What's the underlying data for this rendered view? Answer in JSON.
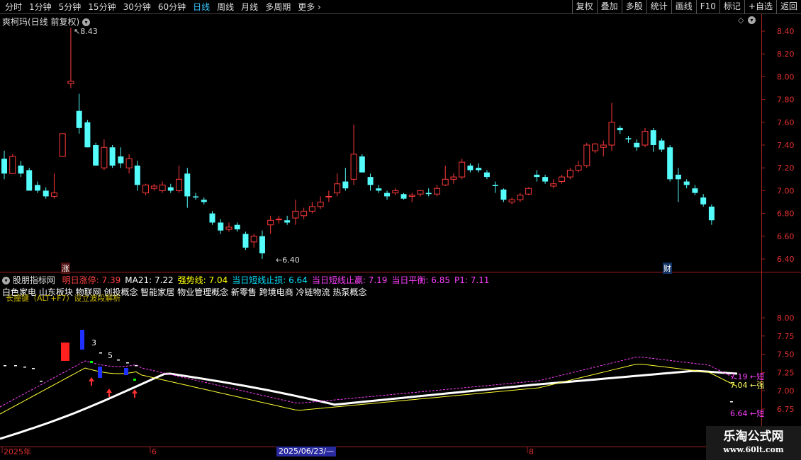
{
  "toolbar": {
    "periods": [
      "分时",
      "1分钟",
      "5分钟",
      "15分钟",
      "30分钟",
      "60分钟",
      "日线",
      "周线",
      "月线",
      "多周期",
      "更多"
    ],
    "active_index": 6,
    "buttons": [
      "复权",
      "叠加",
      "多股",
      "统计",
      "画线",
      "F10",
      "标记",
      "+自选",
      "返回"
    ]
  },
  "main": {
    "title": "爽柯玛(日线 前复权)",
    "high_label": "8.43",
    "low_label": "6.40",
    "marker_zhang": "涨",
    "marker_cai": "财",
    "y_ticks": [
      "8.40",
      "8.20",
      "8.00",
      "7.80",
      "7.60",
      "7.40",
      "7.20",
      "7.00",
      "6.80",
      "6.60",
      "6.40"
    ]
  },
  "indicator": {
    "name": "股朋指标网",
    "legend": [
      {
        "text": "明日涨停: 7.39",
        "color": "#ff4040"
      },
      {
        "text": "MA21: 7.22",
        "color": "#ffffff"
      },
      {
        "text": "强势线: 7.04",
        "color": "#ffff00"
      },
      {
        "text": "当日短线止损: 6.64",
        "color": "#00e0ff"
      },
      {
        "text": "当日短线止赢: 7.19",
        "color": "#ff40ff"
      },
      {
        "text": "当日平衡: 6.85",
        "color": "#ff40ff"
      },
      {
        "text": "P1: 7.11",
        "color": "#ff40ff"
      }
    ],
    "concepts": "白色家电 山东板块 物联网 创投概念 智能家居 物业管理概念 新零售 跨境电商 冷链物流 热泵概念",
    "overlay_text": "长撞键（ALT+F7）设立波段解析",
    "y_ticks": [
      "8.00",
      "7.75",
      "7.50",
      "7.25",
      "7.00",
      "6.75"
    ],
    "right_labels": [
      {
        "text": "7.19 ←短",
        "color": "#ff40ff"
      },
      {
        "text": "7.04 ←强",
        "color": "#ffff66"
      },
      {
        "text": "6.64 ←短",
        "color": "#ff40ff"
      }
    ],
    "num_3": "3",
    "num_5": "5"
  },
  "xaxis": {
    "labels": [
      "2025年",
      "6",
      "8"
    ],
    "cursor_date": "2025/06/23/—"
  },
  "watermark": {
    "line1": "乐淘公式网",
    "line2": "www.60lt.com"
  },
  "chart_data": {
    "type": "candlestick",
    "ylim": [
      6.35,
      8.5
    ],
    "candles": [
      [
        7.28,
        7.35,
        7.1,
        7.15
      ],
      [
        7.15,
        7.32,
        7.15,
        7.3
      ],
      [
        7.22,
        7.26,
        7.12,
        7.15
      ],
      [
        7.18,
        7.2,
        7.0,
        7.0
      ],
      [
        7.05,
        7.08,
        6.98,
        7.0
      ],
      [
        7.0,
        7.03,
        6.93,
        6.95
      ],
      [
        6.95,
        7.15,
        6.93,
        6.98
      ],
      [
        7.3,
        7.5,
        7.3,
        7.5
      ],
      [
        7.94,
        8.43,
        7.9,
        7.96
      ],
      [
        7.7,
        7.85,
        7.5,
        7.55
      ],
      [
        7.6,
        7.62,
        7.38,
        7.38
      ],
      [
        7.4,
        7.42,
        7.22,
        7.22
      ],
      [
        7.2,
        7.45,
        7.18,
        7.38
      ],
      [
        7.38,
        7.4,
        7.2,
        7.22
      ],
      [
        7.3,
        7.38,
        7.2,
        7.24
      ],
      [
        7.2,
        7.32,
        7.15,
        7.28
      ],
      [
        7.22,
        7.26,
        7.0,
        7.05
      ],
      [
        6.98,
        7.06,
        6.96,
        7.05
      ],
      [
        7.02,
        7.06,
        7.0,
        7.04
      ],
      [
        7.0,
        7.08,
        6.98,
        7.05
      ],
      [
        7.03,
        7.06,
        6.98,
        7.0
      ],
      [
        7.0,
        7.22,
        6.98,
        7.1
      ],
      [
        7.15,
        7.2,
        6.85,
        6.95
      ],
      [
        6.95,
        6.98,
        6.92,
        6.94
      ],
      [
        6.92,
        6.94,
        6.88,
        6.9
      ],
      [
        6.8,
        6.82,
        6.7,
        6.72
      ],
      [
        6.72,
        6.75,
        6.62,
        6.65
      ],
      [
        6.66,
        6.72,
        6.64,
        6.68
      ],
      [
        6.7,
        6.72,
        6.64,
        6.66
      ],
      [
        6.62,
        6.64,
        6.48,
        6.5
      ],
      [
        6.55,
        6.62,
        6.5,
        6.6
      ],
      [
        6.6,
        6.65,
        6.4,
        6.45
      ],
      [
        6.7,
        6.78,
        6.62,
        6.74
      ],
      [
        6.75,
        6.78,
        6.71,
        6.75
      ],
      [
        6.74,
        6.78,
        6.7,
        6.72
      ],
      [
        6.76,
        6.92,
        6.7,
        6.82
      ],
      [
        6.78,
        6.85,
        6.75,
        6.82
      ],
      [
        6.82,
        6.9,
        6.8,
        6.86
      ],
      [
        6.86,
        6.95,
        6.84,
        6.9
      ],
      [
        6.95,
        7.0,
        6.9,
        6.95
      ],
      [
        6.98,
        7.15,
        6.95,
        7.06
      ],
      [
        7.08,
        7.2,
        7.0,
        7.02
      ],
      [
        7.1,
        7.58,
        7.05,
        7.32
      ],
      [
        7.3,
        7.32,
        7.16,
        7.16
      ],
      [
        7.12,
        7.15,
        7.0,
        7.05
      ],
      [
        7.02,
        7.05,
        6.98,
        7.0
      ],
      [
        6.98,
        7.0,
        6.92,
        6.95
      ],
      [
        6.98,
        7.02,
        6.96,
        7.0
      ],
      [
        6.97,
        6.98,
        6.92,
        6.93
      ],
      [
        6.95,
        6.98,
        6.9,
        6.96
      ],
      [
        6.97,
        7.0,
        6.95,
        7.0
      ],
      [
        6.98,
        7.02,
        6.95,
        6.97
      ],
      [
        6.97,
        7.05,
        6.95,
        7.02
      ],
      [
        7.05,
        7.22,
        7.04,
        7.1
      ],
      [
        7.1,
        7.15,
        7.06,
        7.12
      ],
      [
        7.12,
        7.28,
        7.1,
        7.25
      ],
      [
        7.22,
        7.24,
        7.16,
        7.18
      ],
      [
        7.2,
        7.24,
        7.16,
        7.18
      ],
      [
        7.16,
        7.18,
        7.1,
        7.12
      ],
      [
        7.05,
        7.08,
        6.98,
        7.04
      ],
      [
        7.01,
        7.02,
        6.9,
        6.92
      ],
      [
        6.9,
        6.94,
        6.88,
        6.92
      ],
      [
        6.92,
        6.98,
        6.9,
        6.96
      ],
      [
        6.97,
        7.03,
        6.96,
        7.02
      ],
      [
        7.14,
        7.18,
        7.08,
        7.12
      ],
      [
        7.12,
        7.14,
        7.06,
        7.08
      ],
      [
        7.04,
        7.1,
        7.02,
        7.06
      ],
      [
        7.08,
        7.14,
        7.06,
        7.12
      ],
      [
        7.12,
        7.2,
        7.1,
        7.18
      ],
      [
        7.18,
        7.26,
        7.16,
        7.22
      ],
      [
        7.22,
        7.42,
        7.2,
        7.4
      ],
      [
        7.35,
        7.42,
        7.33,
        7.41
      ],
      [
        7.38,
        7.44,
        7.3,
        7.4
      ],
      [
        7.4,
        7.77,
        7.35,
        7.6
      ],
      [
        7.55,
        7.57,
        7.5,
        7.53
      ],
      [
        7.46,
        7.48,
        7.42,
        7.45
      ],
      [
        7.42,
        7.45,
        7.35,
        7.38
      ],
      [
        7.4,
        7.55,
        7.38,
        7.52
      ],
      [
        7.53,
        7.55,
        7.34,
        7.4
      ],
      [
        7.44,
        7.46,
        7.34,
        7.36
      ],
      [
        7.38,
        7.4,
        7.08,
        7.1
      ],
      [
        7.14,
        7.2,
        6.9,
        7.1
      ],
      [
        7.08,
        7.1,
        7.02,
        7.05
      ],
      [
        7.02,
        7.05,
        6.96,
        6.98
      ],
      [
        6.94,
        6.97,
        6.86,
        6.88
      ],
      [
        6.86,
        6.88,
        6.7,
        6.74
      ]
    ]
  }
}
